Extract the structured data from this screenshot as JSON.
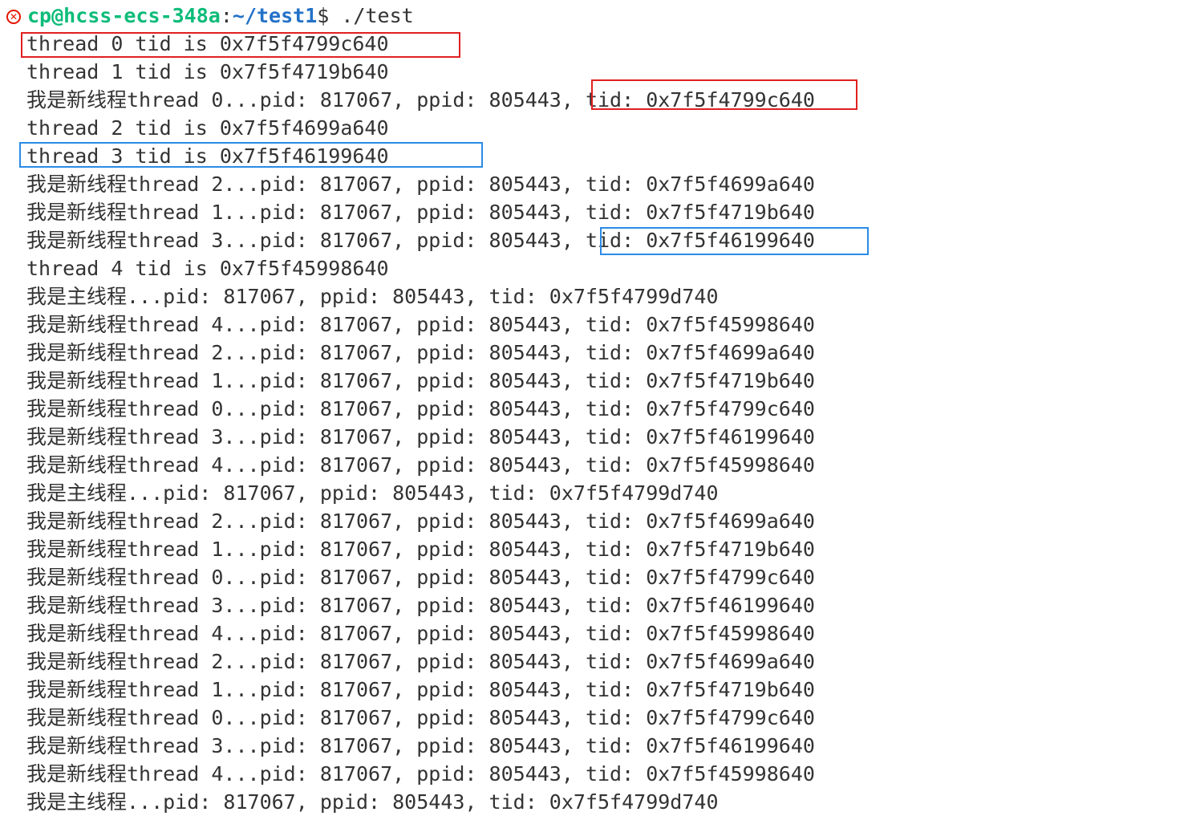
{
  "prompt": {
    "user_host": "cp@hcss-ecs-348a",
    "colon": ":",
    "path": "~/test1",
    "dollar": "$",
    "command": " ./test"
  },
  "colors": {
    "highlight_red": "#e02020",
    "highlight_blue": "#2b8be6"
  },
  "lines": [
    "thread 0 tid is 0x7f5f4799c640",
    "thread 1 tid is 0x7f5f4719b640",
    "我是新线程thread 0...pid: 817067, ppid: 805443, tid: 0x7f5f4799c640",
    "thread 2 tid is 0x7f5f4699a640",
    "thread 3 tid is 0x7f5f46199640",
    "我是新线程thread 2...pid: 817067, ppid: 805443, tid: 0x7f5f4699a640",
    "我是新线程thread 1...pid: 817067, ppid: 805443, tid: 0x7f5f4719b640",
    "我是新线程thread 3...pid: 817067, ppid: 805443, tid: 0x7f5f46199640",
    "thread 4 tid is 0x7f5f45998640",
    "我是主线程...pid: 817067, ppid: 805443, tid: 0x7f5f4799d740",
    "我是新线程thread 4...pid: 817067, ppid: 805443, tid: 0x7f5f45998640",
    "我是新线程thread 2...pid: 817067, ppid: 805443, tid: 0x7f5f4699a640",
    "我是新线程thread 1...pid: 817067, ppid: 805443, tid: 0x7f5f4719b640",
    "我是新线程thread 0...pid: 817067, ppid: 805443, tid: 0x7f5f4799c640",
    "我是新线程thread 3...pid: 817067, ppid: 805443, tid: 0x7f5f46199640",
    "我是新线程thread 4...pid: 817067, ppid: 805443, tid: 0x7f5f45998640",
    "我是主线程...pid: 817067, ppid: 805443, tid: 0x7f5f4799d740",
    "我是新线程thread 2...pid: 817067, ppid: 805443, tid: 0x7f5f4699a640",
    "我是新线程thread 1...pid: 817067, ppid: 805443, tid: 0x7f5f4719b640",
    "我是新线程thread 0...pid: 817067, ppid: 805443, tid: 0x7f5f4799c640",
    "我是新线程thread 3...pid: 817067, ppid: 805443, tid: 0x7f5f46199640",
    "我是新线程thread 4...pid: 817067, ppid: 805443, tid: 0x7f5f45998640",
    "我是新线程thread 2...pid: 817067, ppid: 805443, tid: 0x7f5f4699a640",
    "我是新线程thread 1...pid: 817067, ppid: 805443, tid: 0x7f5f4719b640",
    "我是新线程thread 0...pid: 817067, ppid: 805443, tid: 0x7f5f4799c640",
    "我是新线程thread 3...pid: 817067, ppid: 805443, tid: 0x7f5f46199640",
    "我是新线程thread 4...pid: 817067, ppid: 805443, tid: 0x7f5f45998640",
    "我是主线程...pid: 817067, ppid: 805443, tid: 0x7f5f4799d740"
  ]
}
